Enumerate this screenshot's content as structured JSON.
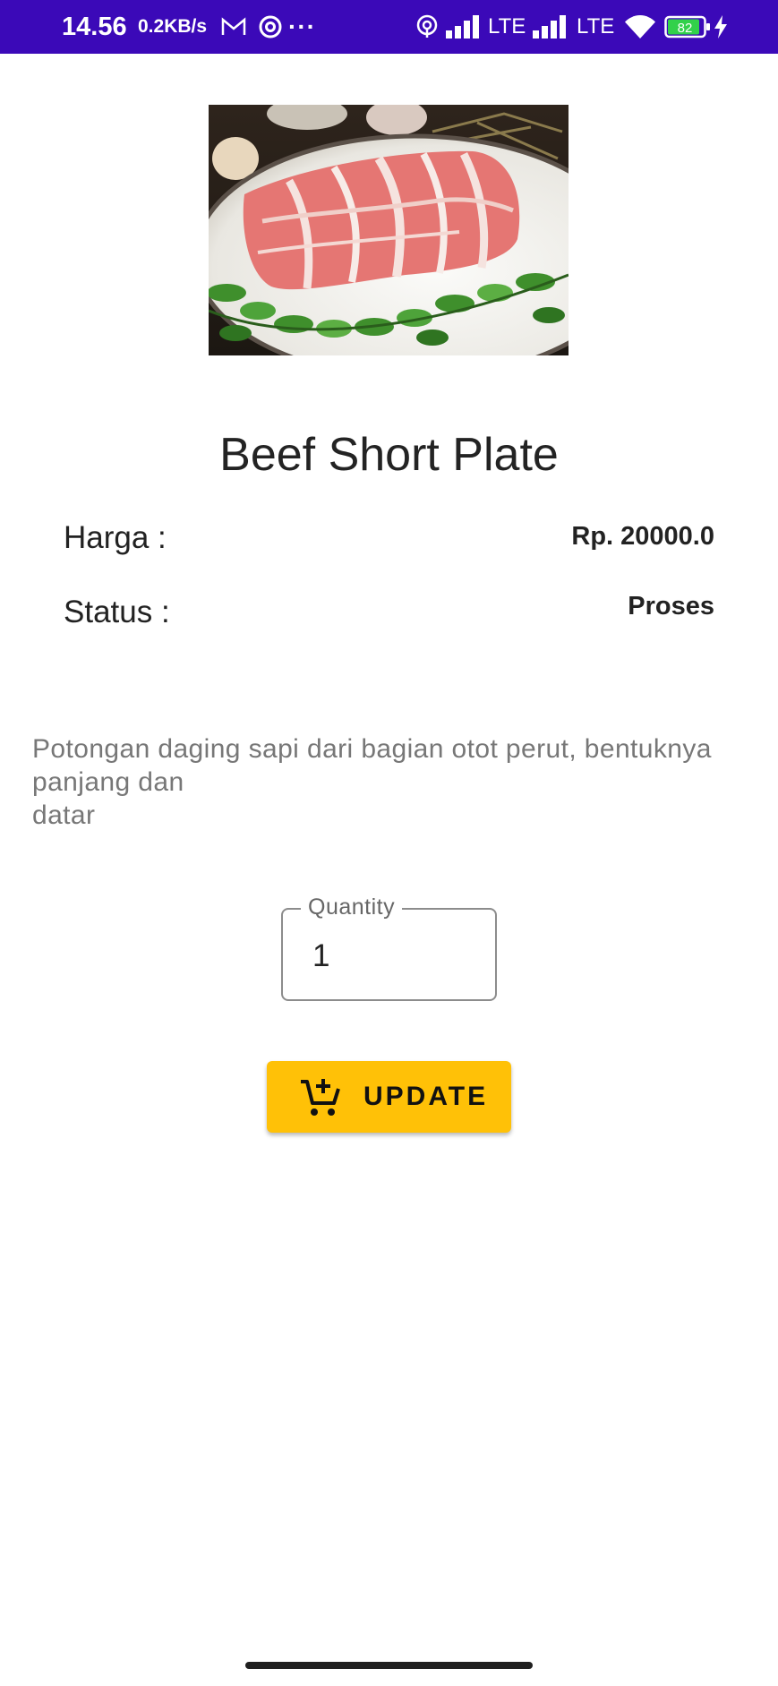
{
  "status_bar": {
    "time": "14.56",
    "net_speed": "0.2KB/s",
    "more": "···",
    "lte_1": "LTE",
    "lte_2": "LTE",
    "battery": "82",
    "icons": [
      "mail-icon",
      "at-icon",
      "hotspot-icon",
      "signal-icon",
      "wifi-icon",
      "battery-icon",
      "charging-icon"
    ]
  },
  "product": {
    "image_icon": "beef-photo",
    "name": "Beef Short Plate",
    "price_label": "Harga :",
    "price_value": "Rp. 20000.0",
    "status_label": "Status :",
    "status_value": "Proses",
    "description": "Potongan daging sapi dari bagian otot perut, bentuknya\npanjang dan\ndatar"
  },
  "quantity": {
    "label": "Quantity",
    "value": "1"
  },
  "update_button": {
    "label": "UPDATE",
    "icon": "add-to-cart-icon",
    "color": "#ffc107"
  },
  "colors": {
    "status_bar": "#3b09b8",
    "background": "#ffffff"
  }
}
